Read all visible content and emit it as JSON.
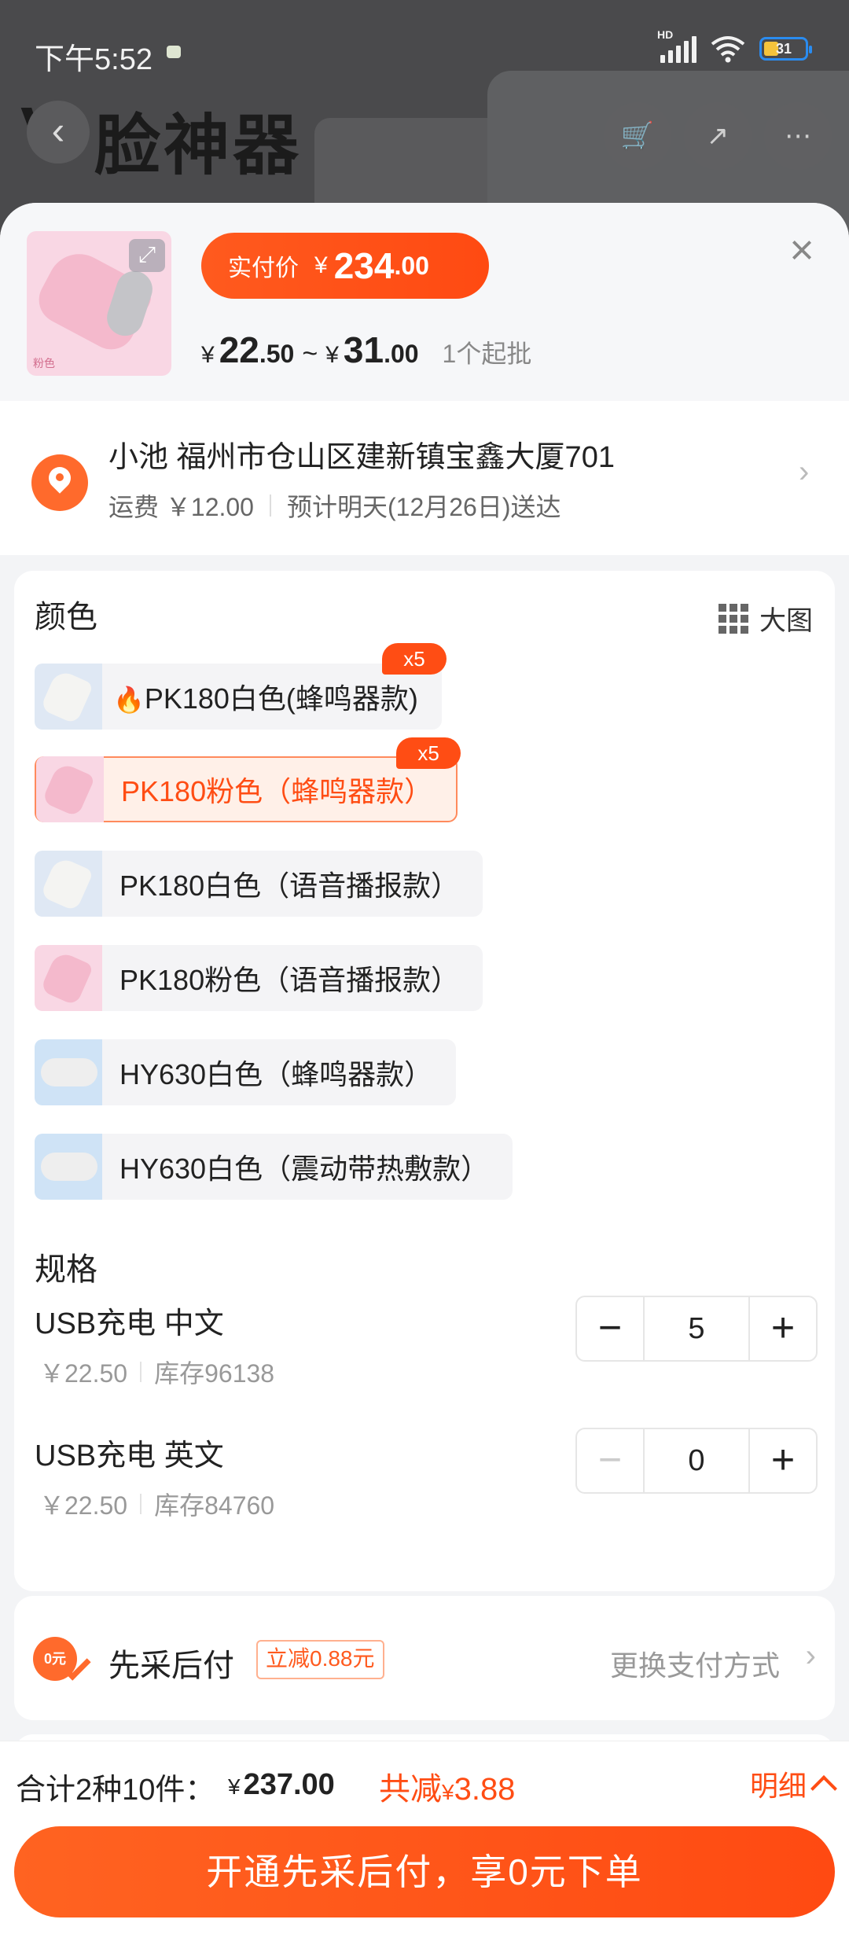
{
  "status_bar": {
    "time": "下午5:52",
    "network": "HD",
    "battery": "31"
  },
  "background": {
    "title": "脸神器",
    "logo": "V"
  },
  "header": {
    "pay_label": "实付价",
    "pay_currency": "¥",
    "pay_integer": "234",
    "pay_decimal": ".00",
    "price_min_currency": "¥",
    "price_min_integer": "22",
    "price_min_decimal": ".50",
    "range_sep": "~",
    "price_max_currency": "¥",
    "price_max_integer": "31",
    "price_max_decimal": ".00",
    "moq": "1个起批",
    "thumb_tag": "粉色"
  },
  "address": {
    "line": "小池 福州市仓山区建新镇宝鑫大厦701",
    "shipping": "运费 ￥12.00",
    "delivery": "预计明天(12月26日)送达"
  },
  "color_section": {
    "title": "颜色",
    "big_view": "大图",
    "options": [
      {
        "label": "PK180白色(蜂鸣器款)",
        "badge": "x5",
        "hot": true
      },
      {
        "label": "PK180粉色（蜂鸣器款）",
        "badge": "x5",
        "selected": true
      },
      {
        "label": "PK180白色（语音播报款）"
      },
      {
        "label": "PK180粉色（语音播报款）"
      },
      {
        "label": "HY630白色（蜂鸣器款）"
      },
      {
        "label": "HY630白色（震动带热敷款）"
      }
    ]
  },
  "spec_section": {
    "title": "规格",
    "items": [
      {
        "name": "USB充电 中文",
        "price": "￥22.50",
        "stock": "库存96138",
        "qty": "5"
      },
      {
        "name": "USB充电 英文",
        "price": "￥22.50",
        "stock": "库存84760",
        "qty": "0"
      }
    ]
  },
  "payment": {
    "title": "先采后付",
    "tag": "立减0.88元",
    "change": "更换支付方式",
    "icon_text": "0元"
  },
  "footer": {
    "total_label": "合计2种10件：",
    "total_currency": "¥",
    "total_amount": "237.00",
    "save_label": "共减",
    "save_currency": "¥",
    "save_amount": "3.88",
    "detail": "明细",
    "cta": "开通先采后付，享0元下单"
  },
  "colors": {
    "accent": "#ff4d14",
    "selected_bg": "#fff0e8"
  }
}
